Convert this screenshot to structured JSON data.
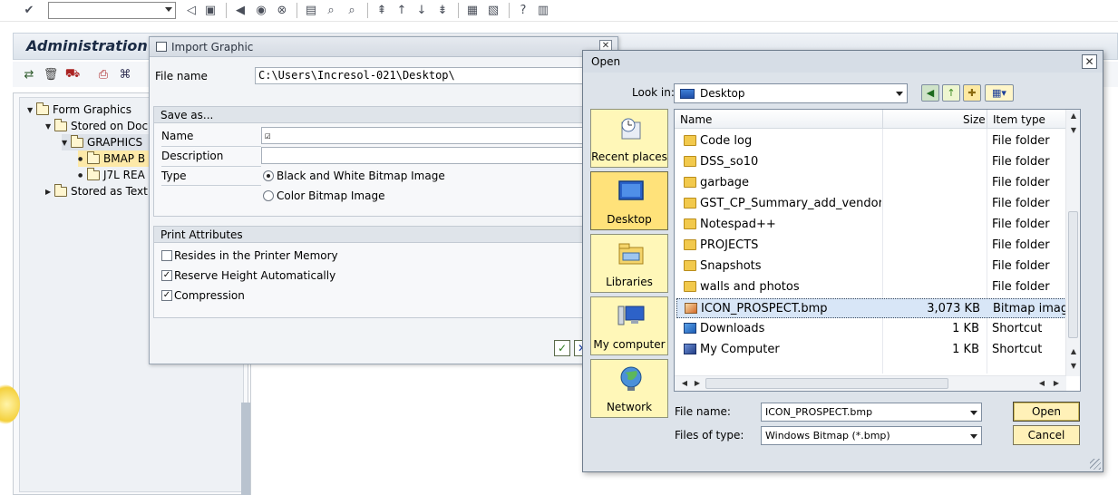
{
  "import_dialog": {
    "title": "Import Graphic",
    "file_name_label": "File name",
    "file_name_value": "C:\\Users\\Incresol-021\\Desktop\\",
    "save_as": {
      "header": "Save as...",
      "name_label": "Name",
      "description_label": "Description",
      "type_label": "Type",
      "type_options": [
        "Black and White Bitmap Image",
        "Color Bitmap Image"
      ],
      "type_selected": "Black and White Bitmap Image"
    },
    "print_attributes": {
      "header": "Print Attributes",
      "options": [
        {
          "label": "Resides in the Printer Memory",
          "checked": false
        },
        {
          "label": "Reserve Height Automatically",
          "checked": true
        },
        {
          "label": "Compression",
          "checked": true
        }
      ]
    }
  },
  "sap_screen": {
    "title": "Administration o",
    "tree": [
      {
        "label": "Form Graphics"
      },
      {
        "label": "Stored on Doc"
      },
      {
        "label": "GRAPHICS"
      },
      {
        "label": "BMAP B"
      },
      {
        "label": "J7L REA"
      },
      {
        "label": "Stored as Text"
      }
    ]
  },
  "open_dialog": {
    "title": "Open",
    "look_in_label": "Look in:",
    "look_in_value": "Desktop",
    "places": [
      "Recent places",
      "Desktop",
      "Libraries",
      "My computer",
      "Network"
    ],
    "selected_place": "Desktop",
    "columns": {
      "name": "Name",
      "size": "Size",
      "type": "Item type"
    },
    "files": [
      {
        "name": "Code log",
        "size": "",
        "type": "File folder",
        "icon": "folder-icon"
      },
      {
        "name": "DSS_so10",
        "size": "",
        "type": "File folder",
        "icon": "folder-icon"
      },
      {
        "name": "garbage",
        "size": "",
        "type": "File folder",
        "icon": "folder-icon"
      },
      {
        "name": "GST_CP_Summary_add_vendor...",
        "size": "",
        "type": "File folder",
        "icon": "folder-icon"
      },
      {
        "name": "Notespad++",
        "size": "",
        "type": "File folder",
        "icon": "folder-icon"
      },
      {
        "name": "PROJECTS",
        "size": "",
        "type": "File folder",
        "icon": "folder-icon"
      },
      {
        "name": "Snapshots",
        "size": "",
        "type": "File folder",
        "icon": "folder-icon"
      },
      {
        "name": "walls and photos",
        "size": "",
        "type": "File folder",
        "icon": "folder-icon"
      },
      {
        "name": "ICON_PROSPECT.bmp",
        "size": "3,073 KB",
        "type": "Bitmap image",
        "icon": "bitmap-file-icon",
        "selected": true
      },
      {
        "name": "Downloads",
        "size": "1 KB",
        "type": "Shortcut",
        "icon": "shortcut-icon"
      },
      {
        "name": "My Computer",
        "size": "1 KB",
        "type": "Shortcut",
        "icon": "computer-shortcut-icon"
      }
    ],
    "file_name_label": "File name:",
    "file_name_value": "ICON_PROSPECT.bmp",
    "file_type_label": "Files of type:",
    "file_type_value": "Windows Bitmap (*.bmp)",
    "open_button": "Open",
    "cancel_button": "Cancel"
  }
}
